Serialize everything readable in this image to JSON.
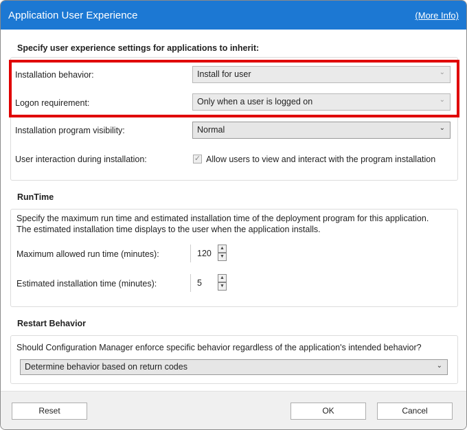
{
  "window": {
    "title": "Application User Experience",
    "more_info": "(More Info)"
  },
  "general": {
    "heading": "Specify user experience settings for applications to inherit:",
    "installation_behavior": {
      "label": "Installation behavior:",
      "value": "Install for user"
    },
    "logon_requirement": {
      "label": "Logon requirement:",
      "value": "Only when a user is logged on"
    },
    "program_visibility": {
      "label": "Installation program visibility:",
      "value": "Normal"
    },
    "user_interaction": {
      "label": "User interaction during installation:",
      "checkbox_label": "Allow users to view and interact with the program installation",
      "checked": true
    }
  },
  "runtime": {
    "heading": "RunTime",
    "description": "Specify the maximum run time and estimated installation time of the deployment program for this application. The estimated installation time displays to the user when the application installs.",
    "max_runtime": {
      "label": "Maximum allowed run time (minutes):",
      "value": "120"
    },
    "est_install": {
      "label": "Estimated installation time (minutes):",
      "value": "5"
    }
  },
  "restart": {
    "heading": "Restart Behavior",
    "question": "Should Configuration Manager enforce specific behavior regardless of the application's intended behavior?",
    "value": "Determine behavior based on return codes"
  },
  "footer": {
    "reset": "Reset",
    "ok": "OK",
    "cancel": "Cancel"
  },
  "icons": {
    "check": "✓",
    "chevron": "⌄",
    "up": "▲",
    "down": "▼"
  }
}
